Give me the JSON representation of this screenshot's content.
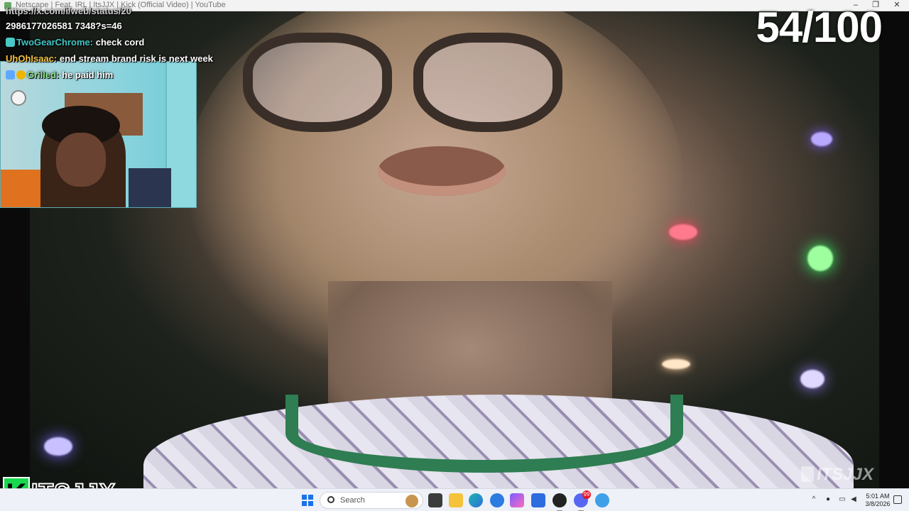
{
  "window": {
    "title": "Netscape | Feat. IRL | ItsJJX | Kick (Official Video) | YouTube",
    "minimize": "–",
    "maximize": "❐",
    "close": "✕"
  },
  "chat": {
    "messages": [
      {
        "user": "",
        "text": "https://x.com/i/web/status/20"
      },
      {
        "user": "",
        "text": "2986177026581 7348?s=46"
      },
      {
        "user": "TwoGearChrome:",
        "text": "check cord",
        "badge": "teal"
      },
      {
        "user": "UhOhIsaac:",
        "text": "end stream brand risk is next week"
      },
      {
        "user": "Grilled:",
        "text": "he paid him",
        "badges": [
          "blue",
          "gold"
        ]
      }
    ]
  },
  "counter": "54/100",
  "logos": {
    "left_k": "K",
    "left_text": "ITSJJX",
    "right_text": "ITSJJX"
  },
  "taskbar": {
    "search_placeholder": "Search",
    "apps": [
      "file-explorer",
      "folder",
      "edge",
      "settings",
      "copilot",
      "store",
      "obs",
      "discord",
      "vpn"
    ],
    "discord_badge": "99",
    "time": "5:01 AM",
    "date": "3/8/2026"
  },
  "colors": {
    "logo_green": "#19d84f",
    "chat_gold": "#f5c241",
    "chat_teal": "#41c6c6"
  }
}
